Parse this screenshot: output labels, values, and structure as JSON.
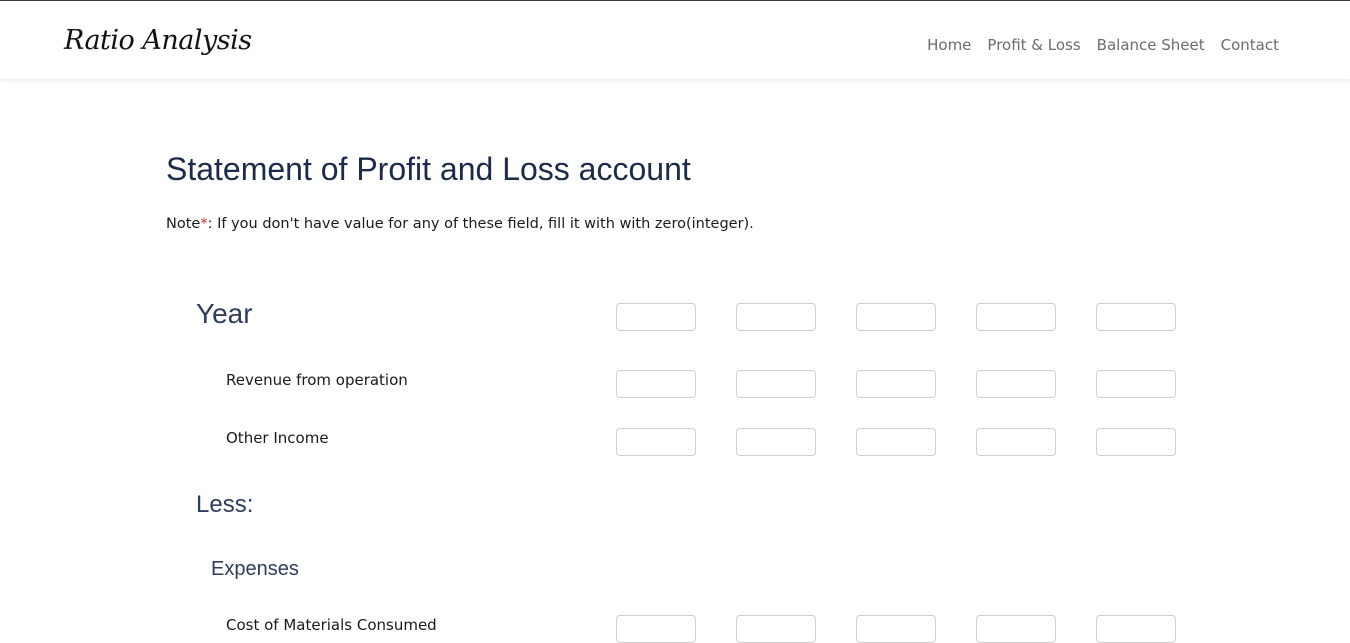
{
  "brand": "Ratio Analysis",
  "nav": {
    "home": "Home",
    "profit_loss": "Profit & Loss",
    "balance_sheet": "Balance Sheet",
    "contact": "Contact"
  },
  "page_title": "Statement of Profit and Loss account",
  "note": {
    "prefix": "Note",
    "star": "*",
    "text": ": If you don't have value for any of these field, fill it with with zero(integer)."
  },
  "sections": {
    "year": "Year",
    "less": "Less:",
    "expenses": "Expenses"
  },
  "rows": {
    "revenue": "Revenue from operation",
    "other_income": "Other Income",
    "cost_materials": "Cost of Materials Consumed"
  },
  "fields": {
    "year": [
      "",
      "",
      "",
      "",
      ""
    ],
    "revenue": [
      "",
      "",
      "",
      "",
      ""
    ],
    "other_income": [
      "",
      "",
      "",
      "",
      ""
    ],
    "cost_materials": [
      "",
      "",
      "",
      "",
      ""
    ]
  }
}
